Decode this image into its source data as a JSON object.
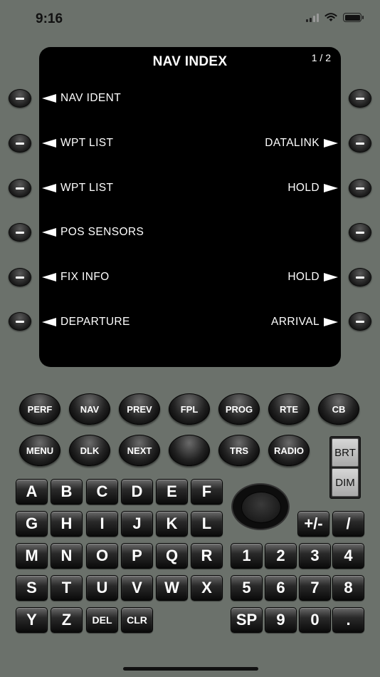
{
  "status_bar": {
    "time": "9:16"
  },
  "screen": {
    "title": "NAV INDEX",
    "page": "1 / 2",
    "left_lines": [
      "NAV IDENT",
      "WPT LIST",
      "WPT LIST",
      "POS SENSORS",
      "FIX INFO",
      "DEPARTURE"
    ],
    "right_lines": [
      "",
      "DATALINK",
      "HOLD",
      "",
      "HOLD",
      "ARRIVAL"
    ]
  },
  "function_keys": {
    "row1": [
      "PERF",
      "NAV",
      "PREV",
      "FPL",
      "PROG",
      "RTE",
      "CB"
    ],
    "row2": [
      "MENU",
      "DLK",
      "NEXT",
      "",
      "TRS",
      "RADIO"
    ]
  },
  "brightness": {
    "brt": "BRT",
    "dim": "DIM"
  },
  "keyboard": {
    "letters_rows": [
      [
        "A",
        "B",
        "C",
        "D",
        "E",
        "F"
      ],
      [
        "G",
        "H",
        "I",
        "J",
        "K",
        "L"
      ],
      [
        "M",
        "N",
        "O",
        "P",
        "Q",
        "R"
      ],
      [
        "S",
        "T",
        "U",
        "V",
        "W",
        "X"
      ],
      [
        "Y",
        "Z",
        "DEL",
        "CLR"
      ]
    ],
    "numeric_rows": [
      [
        "+/-",
        "/"
      ],
      [
        "1",
        "2",
        "3",
        "4"
      ],
      [
        "5",
        "6",
        "7",
        "8"
      ],
      [
        "SP",
        "9",
        "0",
        "."
      ]
    ]
  },
  "colors": {
    "background": "#6b716b",
    "screen": "#000000",
    "text": "#ffffff"
  }
}
